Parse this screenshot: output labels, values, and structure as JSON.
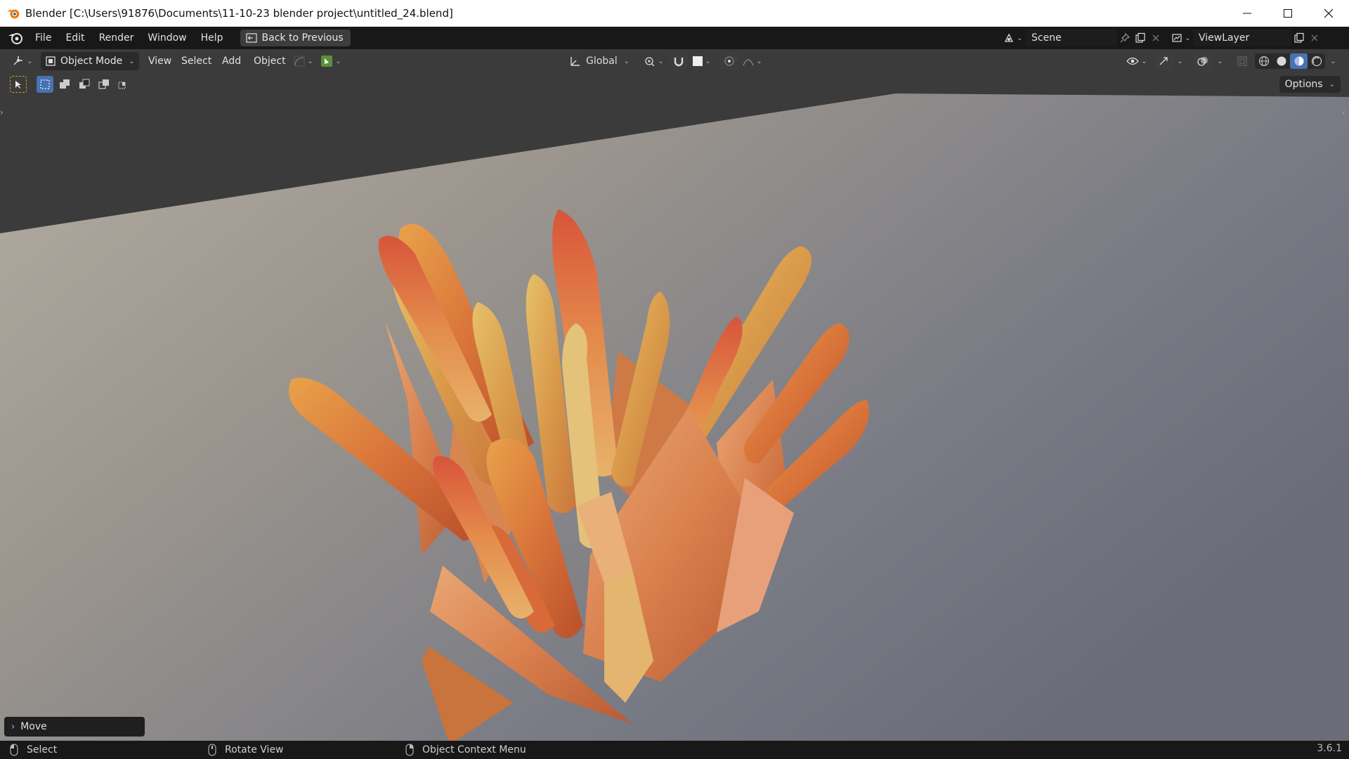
{
  "window": {
    "title": "Blender [C:\\Users\\91876\\Documents\\11-10-23 blender project\\untitled_24.blend]"
  },
  "topbar": {
    "menus": [
      "File",
      "Edit",
      "Render",
      "Window",
      "Help"
    ],
    "back_button": "Back to Previous",
    "scene_name": "Scene",
    "view_layer": "ViewLayer"
  },
  "viewport_header": {
    "mode": "Object Mode",
    "menus": [
      "View",
      "Select",
      "Add",
      "Object"
    ],
    "orientation": "Global",
    "options": "Options"
  },
  "last_operator": "Move",
  "statusbar": {
    "left_click": "Select",
    "middle_click": "Rotate View",
    "right_click": "Object Context Menu",
    "version": "3.6.1"
  },
  "colors": {
    "accent_blue": "#4772b3",
    "header_bg": "#181818",
    "button_bg": "#3d3d3d",
    "snap_active": "#5a8f3a"
  }
}
